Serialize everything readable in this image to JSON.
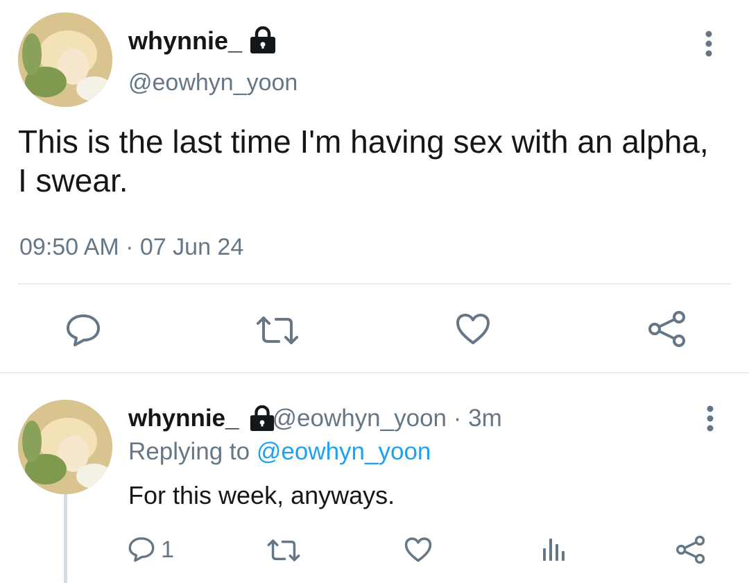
{
  "main_tweet": {
    "display_name": "whynnie_",
    "handle": "@eowhyn_yoon",
    "text": "This is the last time I'm having sex with an alpha, I swear.",
    "time": "09:50 AM",
    "separator": "·",
    "date": "07 Jun 24",
    "icons": {
      "lock": "lock-icon",
      "more": "more-vertical-icon",
      "reply": "reply-icon",
      "retweet": "retweet-icon",
      "like": "heart-icon",
      "share": "share-icon"
    }
  },
  "reply_tweet": {
    "display_name": "whynnie_",
    "handle": "@eowhyn_yoon",
    "separator": "·",
    "age": "3m",
    "replying_prefix": "Replying to",
    "replying_to": "@eowhyn_yoon",
    "text": "For this week, anyways.",
    "reply_count": "1",
    "icons": {
      "lock": "lock-icon",
      "more": "more-vertical-icon",
      "reply": "reply-icon",
      "retweet": "retweet-icon",
      "like": "heart-icon",
      "analytics": "analytics-icon",
      "share": "share-icon"
    }
  },
  "colors": {
    "text": "#14171a",
    "muted": "#657786",
    "link": "#1da1f2",
    "divider": "#e6ecf0"
  }
}
